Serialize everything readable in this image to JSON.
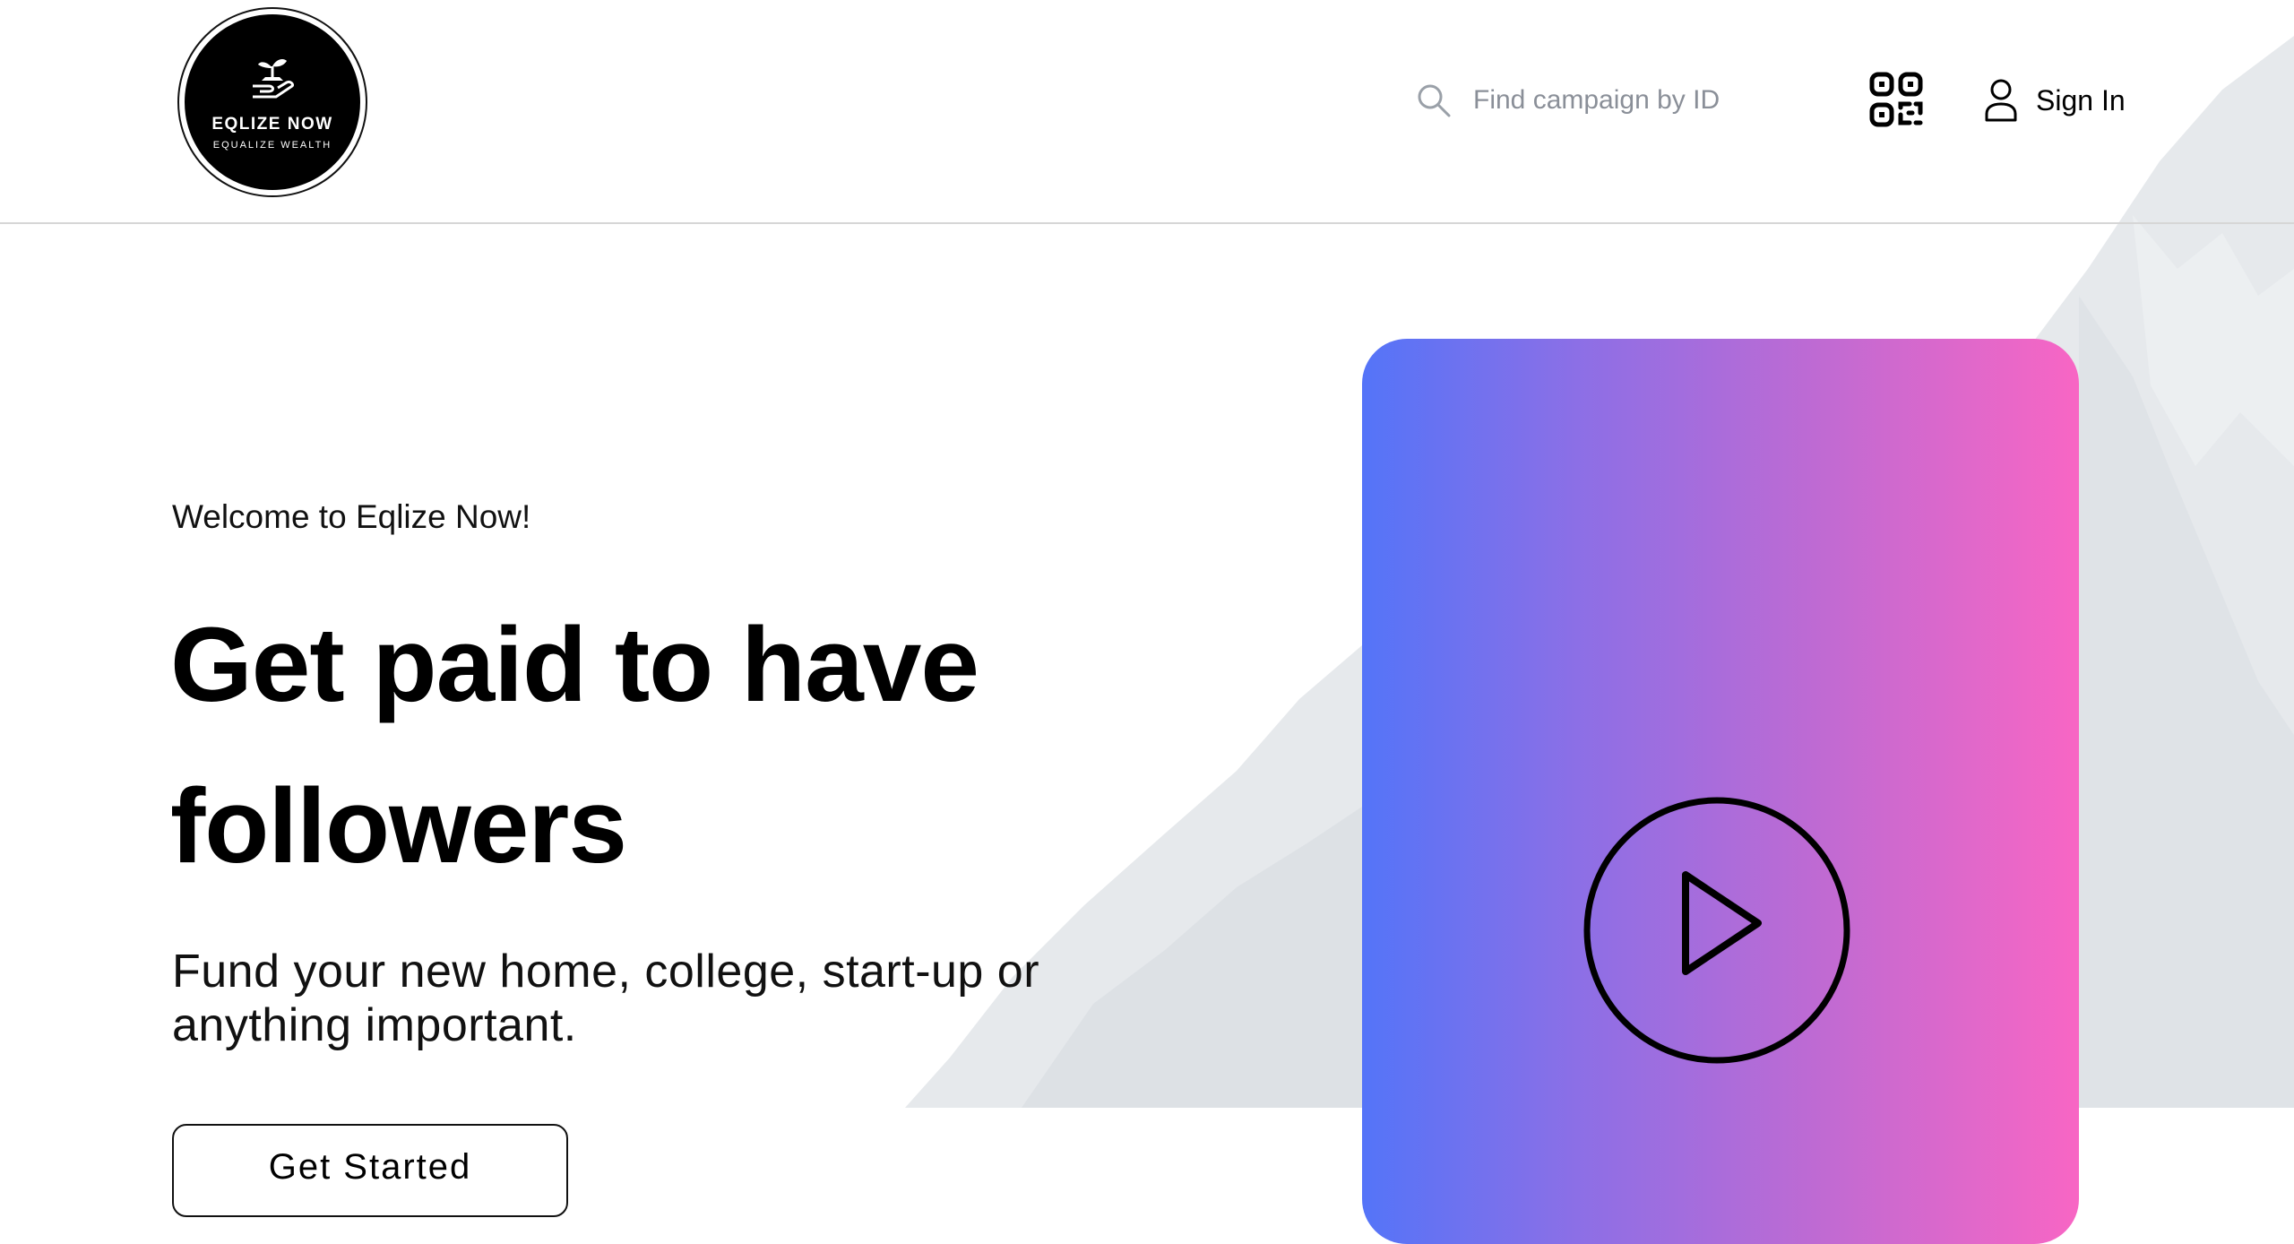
{
  "header": {
    "logo": {
      "name": "EQLIZE NOW",
      "tagline": "EQUALIZE WEALTH"
    },
    "search": {
      "placeholder": "Find campaign by ID",
      "icon": "search-icon"
    },
    "qr": {
      "icon": "qr-code-icon"
    },
    "signin": {
      "label": "Sign In",
      "icon": "user-icon"
    }
  },
  "hero": {
    "welcome": "Welcome to Eqlize Now!",
    "title": "Get paid to have followers",
    "subtitle": "Fund your new home, college, start-up or anything important.",
    "cta_label": "Get Started"
  },
  "video": {
    "icon": "play-icon",
    "gradient": [
      "#5474f8",
      "#f866c4"
    ]
  },
  "colors": {
    "text": "#000000",
    "placeholder": "#8a8f98",
    "divider": "#d6d6d6"
  }
}
